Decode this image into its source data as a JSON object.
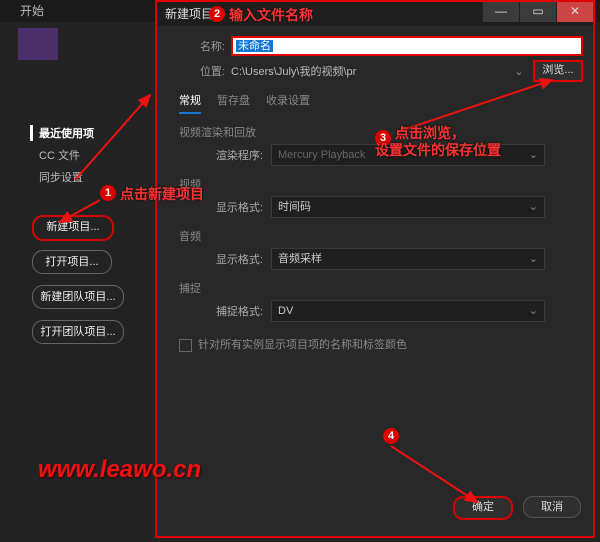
{
  "topbar": {
    "title": "开始"
  },
  "sidebar": {
    "header": "最近使用项",
    "items": [
      "CC 文件",
      "同步设置"
    ],
    "buttons": [
      {
        "label": "新建项目..."
      },
      {
        "label": "打开项目..."
      },
      {
        "label": "新建团队项目..."
      },
      {
        "label": "打开团队项目..."
      }
    ]
  },
  "dialog": {
    "title": "新建项目",
    "window": {
      "min_icon": "—",
      "max_icon": "▭",
      "close_icon": "✕"
    },
    "name_label": "名称:",
    "name_value": "未命名",
    "loc_label": "位置:",
    "loc_value": "C:\\Users\\July\\我的视频\\pr",
    "browse_label": "浏览...",
    "tabs": [
      "常规",
      "暂存盘",
      "收录设置"
    ],
    "sections": {
      "render": {
        "title": "视频渲染和回放",
        "row_label": "渲染程序:",
        "value": "Mercury Playback"
      },
      "video": {
        "title": "视频",
        "row_label": "显示格式:",
        "value": "时间码"
      },
      "audio": {
        "title": "音频",
        "row_label": "显示格式:",
        "value": "音频采样"
      },
      "capture": {
        "title": "捕捉",
        "row_label": "捕捉格式:",
        "value": "DV"
      }
    },
    "checkbox_label": "针对所有实例显示项目项的名称和标签颜色",
    "ok_label": "确定",
    "cancel_label": "取消"
  },
  "annotations": {
    "badge1": "1",
    "text1": "点击新建项目",
    "badge2": "2",
    "text2": "输入文件名称",
    "badge3": "3",
    "text3a": "点击浏览，",
    "text3b": "设置文件的保存位置",
    "badge4": "4"
  },
  "watermark": "www.leawo.cn"
}
